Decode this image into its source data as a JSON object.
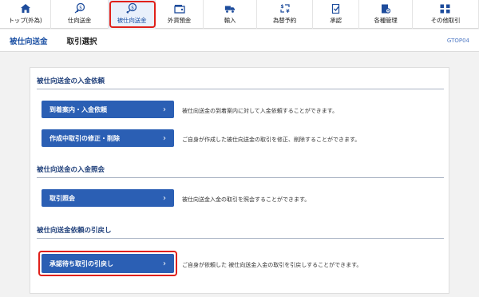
{
  "nav": {
    "items": [
      {
        "label": "トップ(外為)",
        "icon": "home-icon"
      },
      {
        "label": "仕向送金",
        "icon": "send-money-icon"
      },
      {
        "label": "被仕向送金",
        "icon": "receive-money-icon"
      },
      {
        "label": "外貨預金",
        "icon": "deposit-icon"
      },
      {
        "label": "輸入",
        "icon": "import-icon"
      },
      {
        "label": "為替予約",
        "icon": "exchange-contract-icon"
      },
      {
        "label": "承認",
        "icon": "approve-icon"
      },
      {
        "label": "各種管理",
        "icon": "management-icon"
      },
      {
        "label": "その他取引",
        "icon": "other-transactions-icon"
      }
    ],
    "active_index": 2
  },
  "header": {
    "title": "被仕向送金",
    "subtitle": "取引選択",
    "screen_code": "GTOP04"
  },
  "sections": [
    {
      "title": "被仕向送金の入金依頼",
      "buttons": [
        {
          "label": "到着案内・入金依頼",
          "description": "被仕向送金の到着案内に対して入金依頼することができます。"
        },
        {
          "label": "作成中取引の修正・削除",
          "description": "ご自身が作成した被仕向送金の取引を修正、削除することができます。"
        }
      ]
    },
    {
      "title": "被仕向送金の入金照会",
      "buttons": [
        {
          "label": "取引照会",
          "description": "被仕向送金入金の取引を照会することができます。"
        }
      ]
    },
    {
      "title": "被仕向送金依頼の引戻し",
      "buttons": [
        {
          "label": "承認待ち取引の引戻し",
          "description": "ご自身が依頼した 被仕向送金入金の取引を引戻しすることができます。"
        }
      ]
    }
  ],
  "colors": {
    "accent": "#2b5fb4",
    "highlight": "#e0201a"
  }
}
